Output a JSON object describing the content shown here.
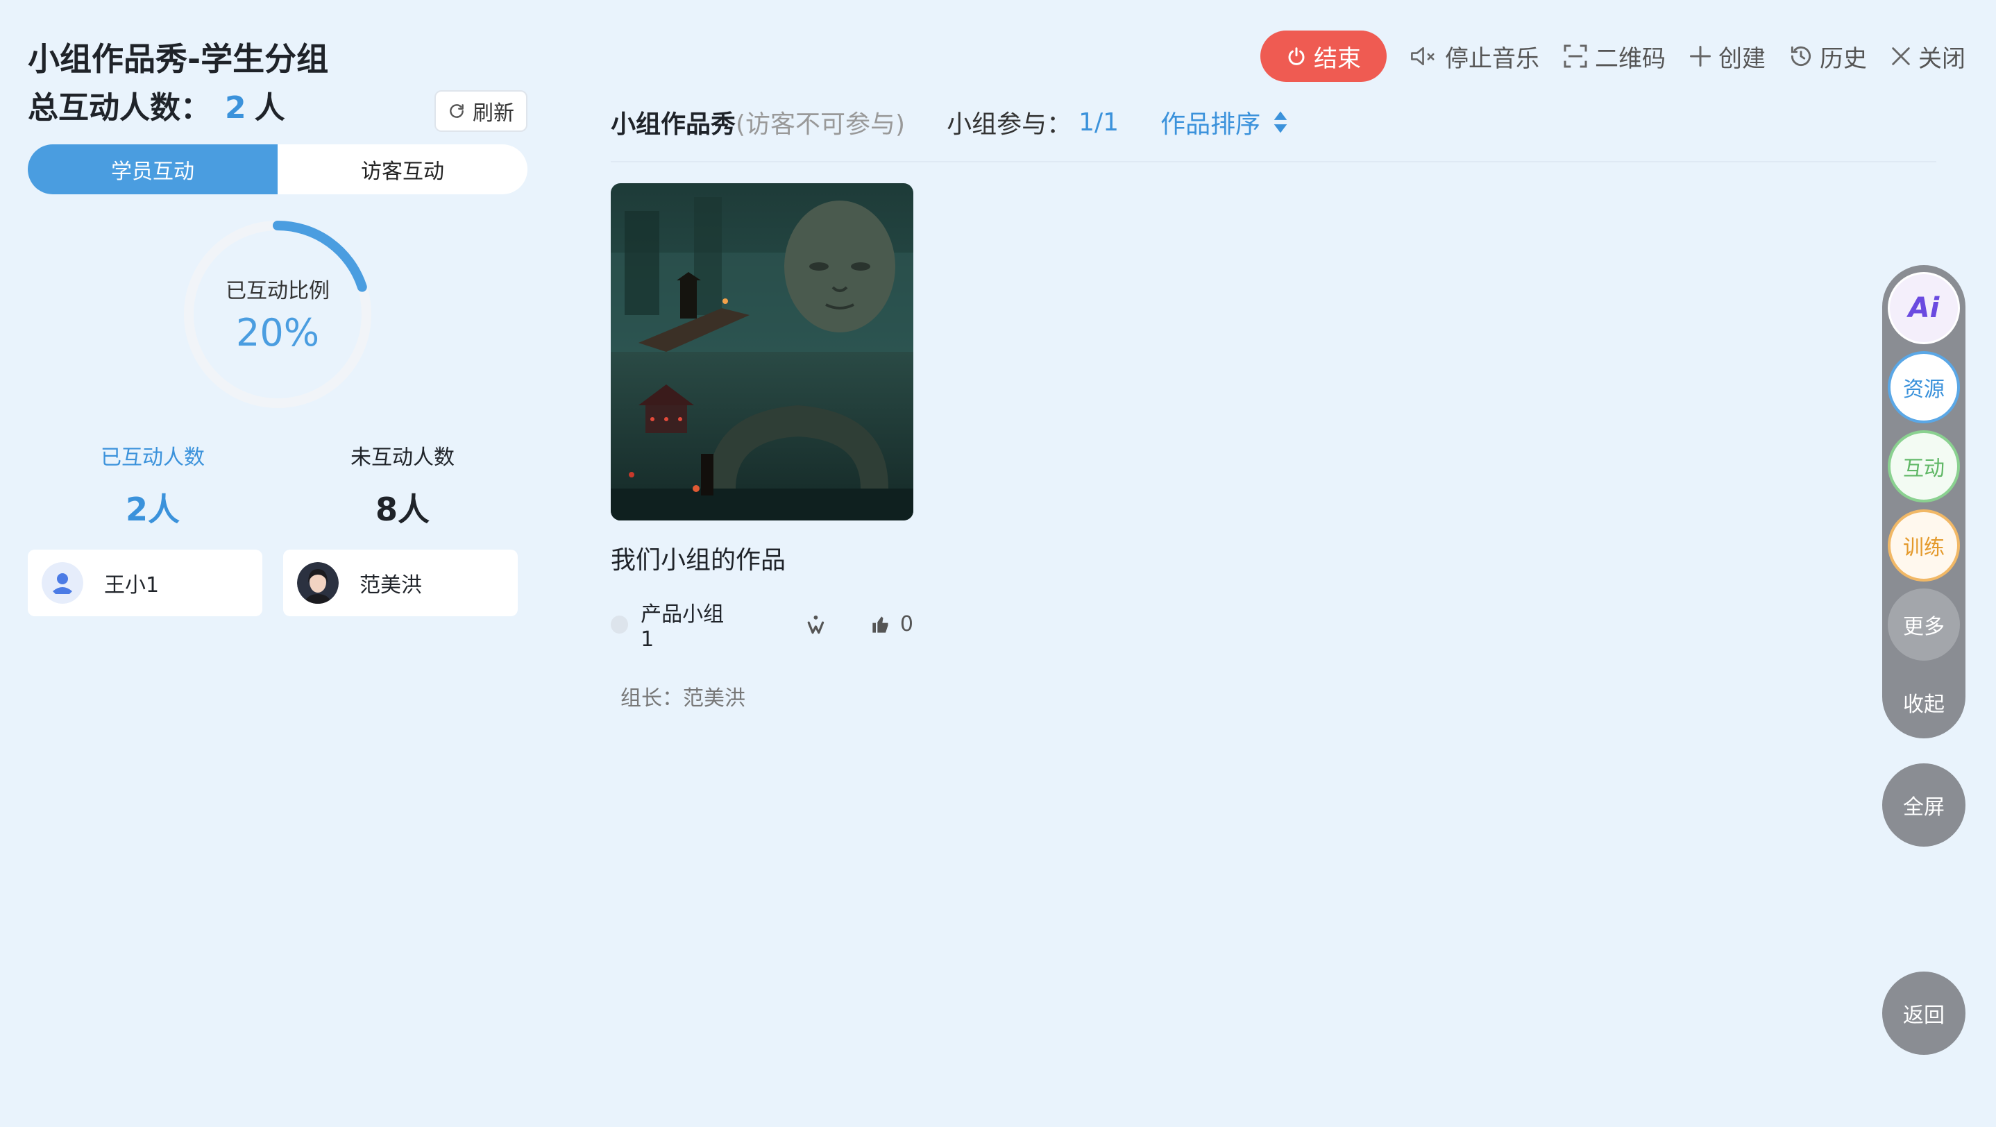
{
  "header": {
    "title": "小组作品秀-学生分组",
    "total_label": "总互动人数：",
    "total_count": "2",
    "total_unit": "人",
    "refresh_label": "刷新"
  },
  "tabs": [
    {
      "label": "学员互动",
      "active": true
    },
    {
      "label": "访客互动",
      "active": false
    }
  ],
  "ring": {
    "caption": "已互动比例",
    "value": "20%",
    "fraction": 0.2,
    "color": "#4a9de0"
  },
  "stats": {
    "interacted_label": "已互动人数",
    "interacted_value": "2人",
    "not_interacted_label": "未互动人数",
    "not_interacted_value": "8人"
  },
  "users": [
    {
      "name": "王小1",
      "avatar": "default-avatar-icon"
    },
    {
      "name": "范美洪",
      "avatar": "photo-avatar"
    }
  ],
  "toolbar": {
    "end_label": "结束",
    "stop_music_label": "停止音乐",
    "qrcode_label": "二维码",
    "create_label": "创建",
    "history_label": "历史",
    "close_label": "关闭"
  },
  "main": {
    "title": "小组作品秀",
    "subtitle": "(访客不可参与)",
    "join_label": "小组参与：",
    "join_value": "1/1",
    "sort_label": "作品排序"
  },
  "works": [
    {
      "title": "我们小组的作品",
      "group": "产品小组1",
      "likes": "0",
      "leader": "组长：范美洪"
    }
  ],
  "rail": {
    "ai_label": "Ai",
    "resource_label": "资源",
    "interact_label": "互动",
    "train_label": "训练",
    "more_label": "更多",
    "collapse_label": "收起",
    "fullscreen_label": "全屏",
    "back_label": "返回"
  },
  "colors": {
    "accent": "#4a9de0",
    "end_button": "#ef5b52",
    "background": "#e9f3fc"
  }
}
